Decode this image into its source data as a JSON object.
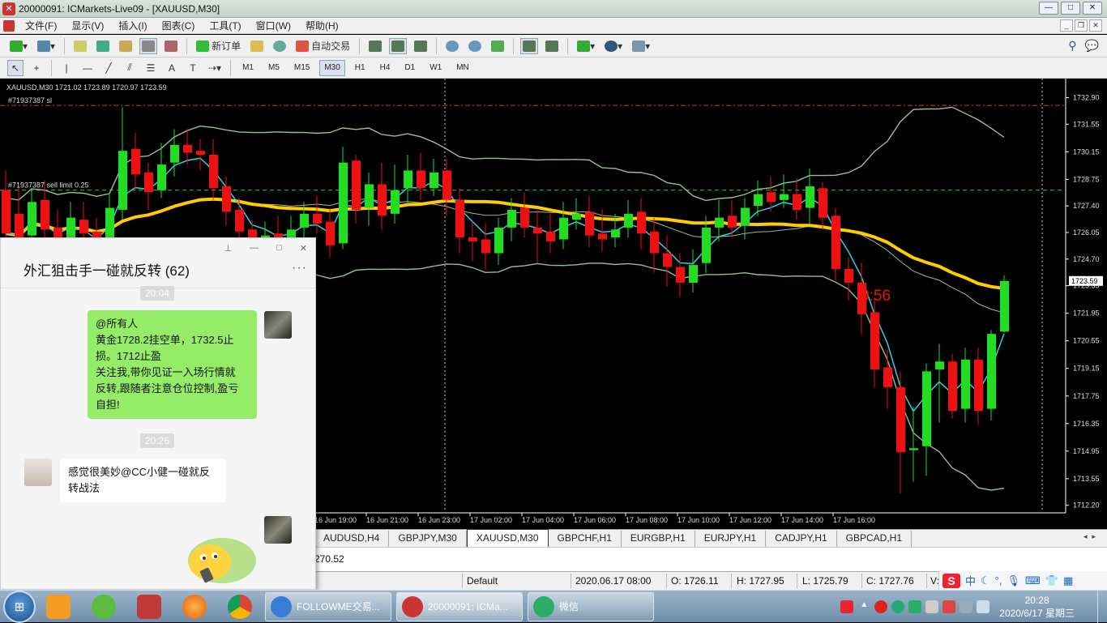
{
  "window": {
    "title": "20000091: ICMarkets-Live09 - [XAUUSD,M30]"
  },
  "menu": [
    "文件(F)",
    "显示(V)",
    "插入(I)",
    "图表(C)",
    "工具(T)",
    "窗口(W)",
    "帮助(H)"
  ],
  "toolbar": {
    "new_order": "新订单",
    "auto_trade": "自动交易"
  },
  "timeframes": [
    "M1",
    "M5",
    "M15",
    "M30",
    "H1",
    "H4",
    "D1",
    "W1",
    "MN"
  ],
  "active_timeframe": "M30",
  "chart": {
    "header": "XAUUSD,M30  1721.02 1723.89 1720.97 1723.59",
    "sl_label": "#71937387 sl",
    "sell_limit_label": "#71937387 sell limit 0.25",
    "countdown": "0:56",
    "current_price": "1723.59",
    "colors": {
      "up": "#22dd22",
      "down": "#ee1111",
      "ma": "#ffcc00",
      "bands": "#99bb99",
      "fast_ma": "#33ccee"
    }
  },
  "chart_data": {
    "type": "candlestick",
    "symbol": "XAUUSD",
    "timeframe": "M30",
    "y_ticks": [
      "1732.90",
      "1731.55",
      "1730.15",
      "1728.75",
      "1727.40",
      "1726.05",
      "1724.70",
      "1723.35",
      "1721.95",
      "1720.55",
      "1719.15",
      "1717.75",
      "1716.35",
      "1714.95",
      "1713.55",
      "1712.20"
    ],
    "ylim": [
      1711.9,
      1733.7
    ],
    "x_ticks": [
      "16 Jun 19:00",
      "16 Jun 21:00",
      "16 Jun 23:00",
      "17 Jun 02:00",
      "17 Jun 04:00",
      "17 Jun 06:00",
      "17 Jun 08:00",
      "17 Jun 10:00",
      "17 Jun 12:00",
      "17 Jun 14:00",
      "17 Jun 16:00"
    ],
    "sl_price": 1732.5,
    "sell_limit_price": 1728.2,
    "last_candle": {
      "open": 1721.02,
      "high": 1723.89,
      "low": 1720.97,
      "close": 1723.59
    },
    "candles": [
      [
        1728.2,
        1726.0,
        1729.2,
        1725.3
      ],
      [
        1727.0,
        1725.8,
        1728.4,
        1724.9
      ],
      [
        1725.9,
        1727.6,
        1728.3,
        1725.2
      ],
      [
        1727.7,
        1726.2,
        1728.7,
        1725.8
      ],
      [
        1726.3,
        1725.3,
        1727.2,
        1724.9
      ],
      [
        1725.4,
        1726.8,
        1727.6,
        1725.0
      ],
      [
        1726.7,
        1726.0,
        1727.6,
        1725.3
      ],
      [
        1726.1,
        1725.0,
        1726.8,
        1724.5
      ],
      [
        1725.1,
        1727.3,
        1728.1,
        1724.8
      ],
      [
        1727.2,
        1730.2,
        1732.4,
        1726.7
      ],
      [
        1730.3,
        1729.0,
        1731.1,
        1728.2
      ],
      [
        1729.1,
        1728.1,
        1729.6,
        1727.2
      ],
      [
        1728.2,
        1729.5,
        1730.6,
        1727.8
      ],
      [
        1729.6,
        1730.5,
        1731.3,
        1728.9
      ],
      [
        1730.5,
        1730.1,
        1731.3,
        1729.5
      ],
      [
        1730.2,
        1730.0,
        1730.8,
        1729.2
      ],
      [
        1730.0,
        1728.3,
        1730.8,
        1727.7
      ],
      [
        1728.4,
        1727.1,
        1728.9,
        1726.4
      ],
      [
        1727.2,
        1726.1,
        1727.8,
        1725.8
      ],
      [
        1726.2,
        1724.9,
        1726.7,
        1724.2
      ],
      [
        1725.0,
        1725.9,
        1726.6,
        1724.6
      ],
      [
        1726.0,
        1725.3,
        1726.9,
        1724.8
      ],
      [
        1725.4,
        1726.2,
        1726.9,
        1724.8
      ],
      [
        1726.3,
        1727.0,
        1727.6,
        1725.8
      ],
      [
        1727.0,
        1726.5,
        1727.9,
        1726.0
      ],
      [
        1726.6,
        1725.4,
        1727.3,
        1724.8
      ],
      [
        1725.5,
        1729.6,
        1730.4,
        1725.2
      ],
      [
        1729.7,
        1727.2,
        1730.0,
        1726.5
      ],
      [
        1727.3,
        1728.5,
        1729.1,
        1726.4
      ],
      [
        1728.5,
        1726.9,
        1729.6,
        1726.2
      ],
      [
        1727.0,
        1728.2,
        1729.5,
        1726.5
      ],
      [
        1728.3,
        1729.2,
        1730.0,
        1727.5
      ],
      [
        1729.2,
        1728.3,
        1730.1,
        1727.7
      ],
      [
        1728.3,
        1729.1,
        1729.8,
        1727.9
      ],
      [
        1729.2,
        1727.7,
        1729.8,
        1726.9
      ],
      [
        1727.7,
        1725.8,
        1728.3,
        1725.0
      ],
      [
        1725.8,
        1725.6,
        1726.6,
        1724.6
      ],
      [
        1725.7,
        1725.0,
        1726.5,
        1724.2
      ],
      [
        1725.0,
        1726.3,
        1726.8,
        1724.4
      ],
      [
        1726.3,
        1727.2,
        1727.8,
        1725.6
      ],
      [
        1727.3,
        1726.3,
        1728.1,
        1725.8
      ],
      [
        1726.3,
        1726.0,
        1727.2,
        1724.5
      ],
      [
        1726.1,
        1725.6,
        1727.0,
        1725.0
      ],
      [
        1725.7,
        1726.8,
        1727.6,
        1725.2
      ],
      [
        1726.7,
        1727.0,
        1727.8,
        1726.2
      ],
      [
        1727.1,
        1725.9,
        1727.9,
        1725.3
      ],
      [
        1726.0,
        1725.7,
        1727.2,
        1725.1
      ],
      [
        1725.8,
        1726.2,
        1727.0,
        1725.3
      ],
      [
        1726.3,
        1727.0,
        1727.7,
        1725.8
      ],
      [
        1727.1,
        1726.0,
        1727.8,
        1725.2
      ],
      [
        1726.1,
        1725.0,
        1726.8,
        1724.0
      ],
      [
        1725.0,
        1724.3,
        1725.9,
        1723.3
      ],
      [
        1724.3,
        1723.5,
        1725.0,
        1722.8
      ],
      [
        1723.5,
        1724.4,
        1725.2,
        1723.0
      ],
      [
        1724.5,
        1726.3,
        1726.9,
        1724.0
      ],
      [
        1726.3,
        1726.8,
        1727.7,
        1725.6
      ],
      [
        1726.9,
        1726.3,
        1727.7,
        1725.8
      ],
      [
        1726.4,
        1727.3,
        1727.8,
        1725.7
      ],
      [
        1727.4,
        1728.0,
        1728.7,
        1726.9
      ],
      [
        1728.1,
        1727.6,
        1728.9,
        1727.1
      ],
      [
        1727.7,
        1728.0,
        1729.0,
        1727.3
      ],
      [
        1728.0,
        1727.2,
        1728.8,
        1726.7
      ],
      [
        1727.3,
        1728.4,
        1729.3,
        1726.5
      ],
      [
        1728.3,
        1726.8,
        1728.6,
        1726.2
      ],
      [
        1726.9,
        1724.2,
        1727.3,
        1723.6
      ],
      [
        1724.2,
        1723.5,
        1724.8,
        1722.6
      ],
      [
        1723.5,
        1721.9,
        1724.5,
        1720.9
      ],
      [
        1722.0,
        1719.1,
        1722.7,
        1718.2
      ],
      [
        1719.2,
        1718.2,
        1720.1,
        1717.1
      ],
      [
        1718.2,
        1714.9,
        1719.0,
        1712.8
      ],
      [
        1715.0,
        1715.1,
        1717.2,
        1713.4
      ],
      [
        1715.2,
        1719.0,
        1719.4,
        1713.7
      ],
      [
        1719.1,
        1719.5,
        1720.4,
        1716.4
      ],
      [
        1719.5,
        1717.0,
        1719.9,
        1716.6
      ],
      [
        1717.1,
        1719.6,
        1720.2,
        1716.4
      ],
      [
        1719.6,
        1717.0,
        1720.2,
        1716.3
      ],
      [
        1717.1,
        1720.9,
        1721.1,
        1716.5
      ],
      [
        1721.02,
        1723.59,
        1723.89,
        1720.97
      ]
    ]
  },
  "tabs": [
    "AUDUSD,H4",
    "GBPJPY,M30",
    "XAUUSD,M30",
    "GBPCHF,H1",
    "EURGBP,H1",
    "EURJPY,H1",
    "CADJPY,H1",
    "GBPCAD,H1"
  ],
  "active_tab": "XAUUSD,M30",
  "command_line": "270.52",
  "status": {
    "profile": "Default",
    "datetime": "2020.06.17 08:00",
    "open": "O: 1726.11",
    "high": "H: 1727.95",
    "low": "L: 1725.79",
    "close": "C: 1727.76",
    "volume": "V:"
  },
  "chat": {
    "title": "外汇狙击手一碰就反转 (62)",
    "messages": [
      {
        "time": "20:04",
        "lines": [
          "@所有人",
          "黄金1728.2挂空单，1732.5止",
          "损。1712止盈",
          "关注我,带你见证一入场行情就",
          "反转,跟随者注意仓位控制,盈亏",
          "自担!"
        ]
      },
      {
        "time": "20:26",
        "lines": [
          "感觉很美妙@CC小健一碰就反",
          "转战法"
        ]
      }
    ]
  },
  "taskbar": {
    "items": [
      "FOLLOWME交易...",
      "20000091: ICMa...",
      "微信"
    ],
    "clock_time": "20:28",
    "clock_date": "2020/6/17 星期三"
  }
}
